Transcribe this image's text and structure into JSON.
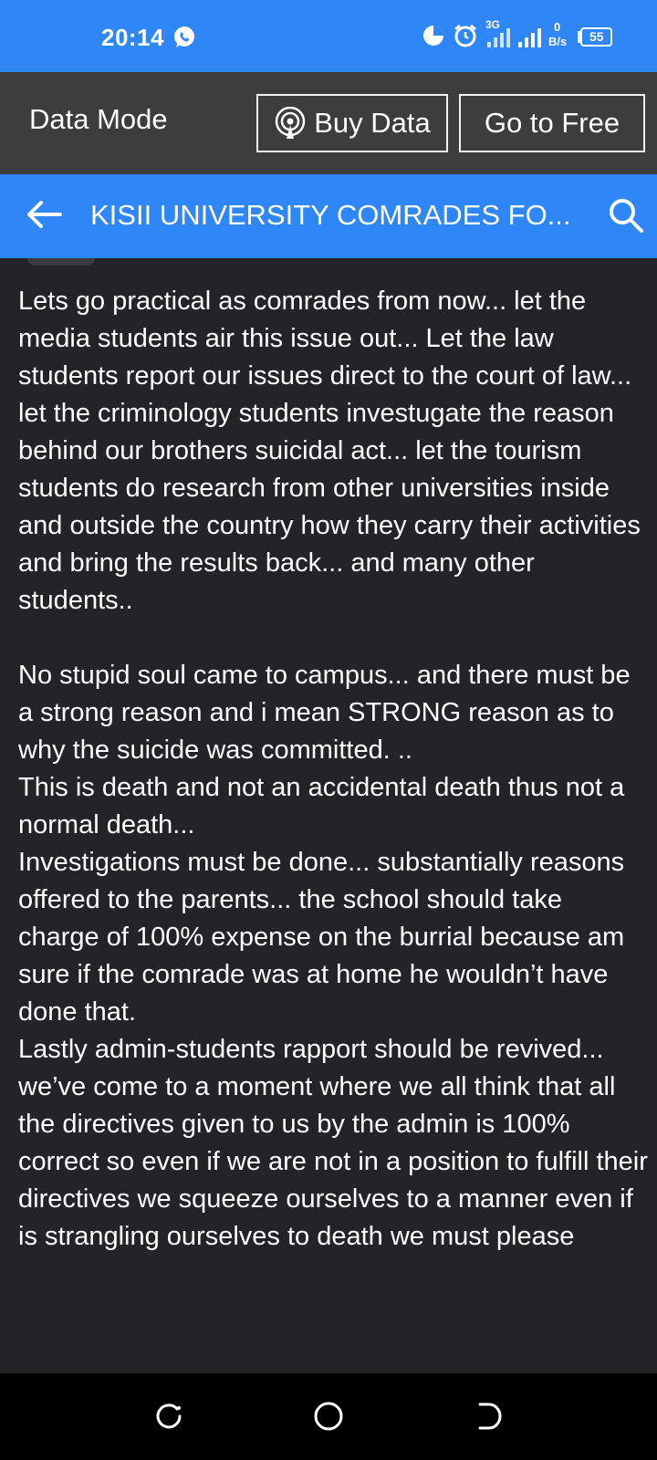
{
  "status_bar": {
    "time": "20:14",
    "network_type": "3G",
    "data_speed_value": "0",
    "data_speed_unit": "B/s",
    "battery": "55"
  },
  "data_mode_bar": {
    "label": "Data Mode",
    "buy_data_label": "Buy Data",
    "go_free_label": "Go to Free"
  },
  "app_bar": {
    "title": "KISII UNIVERSITY COMRADES FO..."
  },
  "post": {
    "paragraphs": [
      "Lets go practical as comrades from now... let the media students air this issue out... Let the law students report our issues direct to the court of law... let the criminology students investugate the reason behind our brothers suicidal act... let the tourism students do research from other universities inside and outside the country how they carry their activities and bring the results back... and many other students..",
      "No stupid soul came to campus... and there must be a strong reason and i mean STRONG reason as to why the suicide was committed. ..",
      "This is death and not an accidental death thus not a normal death...",
      "Investigations must be done... substantially reasons offered to the parents... the school should take charge of 100% expense on the burrial because am sure if the comrade was at home he wouldn’t have done that.",
      "Lastly admin-students rapport should be revived... we’ve come to a moment where we all think that all the directives given to us by the admin is 100% correct so even if we are not in a position to fulfill their directives we squeeze ourselves to a manner even if is strangling ourselves to death we must please"
    ]
  },
  "colors": {
    "accent_blue": "#2f86f6",
    "data_bar_bg": "#3d3d3e",
    "content_bg": "#232427",
    "nav_bg": "#000000"
  },
  "icons": {
    "status_left": "whatsapp-icon",
    "status_right": [
      "data-usage-icon",
      "alarm-icon",
      "signal-icon",
      "battery-icon"
    ],
    "buy_data": "broadcast-icon",
    "back": "back-arrow-icon",
    "search": "search-icon",
    "nav": [
      "recents-icon",
      "home-icon",
      "back-icon"
    ]
  }
}
